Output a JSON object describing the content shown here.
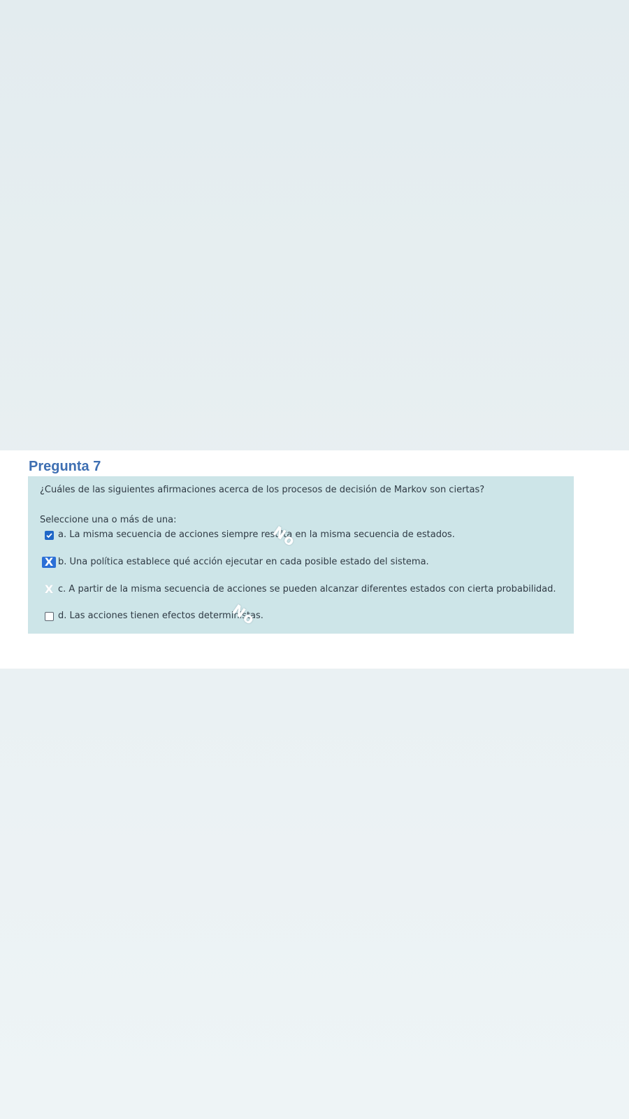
{
  "question": {
    "title": "Pregunta 7",
    "text": "¿Cuáles de las siguientes afirmaciones acerca de los procesos de decisión de Markov son ciertas?",
    "prompt": "Seleccione una o más de una:",
    "options": [
      {
        "label": "a. La misma secuencia de acciones siempre resulta en la misma secuencia de estados.",
        "state": "checked"
      },
      {
        "label": "b. Una política establece qué acción ejecutar en cada posible estado del sistema.",
        "state": "x-mark-blue"
      },
      {
        "label": "c. A partir de la misma secuencia de acciones se pueden alcanzar diferentes estados con cierta probabilidad.",
        "state": "x-mark-white"
      },
      {
        "label": "d. Las acciones tienen efectos deterministas.",
        "state": "unchecked"
      }
    ],
    "stamps": [
      "No",
      "No"
    ],
    "x_glyph": "X"
  },
  "colors": {
    "title": "#3e6fb2",
    "question_box": "#cde5e8",
    "checkbox_checked": "#1f67c7",
    "text": "#2f3a44"
  },
  "icons": [
    "checkbox-checked-icon",
    "x-mark-icon",
    "checkbox-empty-icon"
  ]
}
